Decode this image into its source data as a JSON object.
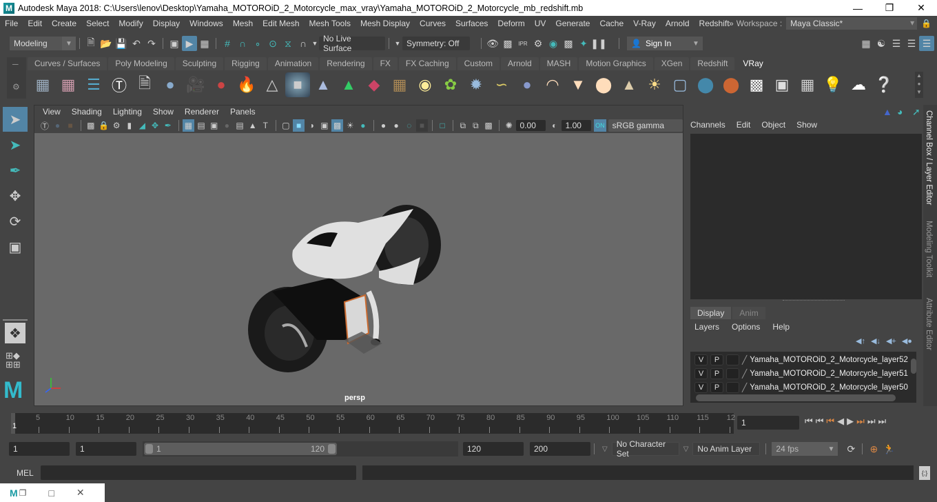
{
  "window": {
    "title": "Autodesk Maya 2018: C:\\Users\\lenov\\Desktop\\Yamaha_MOTOROiD_2_Motorcycle_max_vray\\Yamaha_MOTOROiD_2_Motorcycle_mb_redshift.mb",
    "controls": [
      "minimize",
      "restore",
      "close"
    ]
  },
  "menubar": {
    "items": [
      "File",
      "Edit",
      "Create",
      "Select",
      "Modify",
      "Display",
      "Windows",
      "Mesh",
      "Edit Mesh",
      "Mesh Tools",
      "Mesh Display",
      "Curves",
      "Surfaces",
      "Deform",
      "UV",
      "Generate",
      "Cache",
      "V-Ray",
      "Arnold",
      "Redshift"
    ],
    "workspace_label": "Workspace :",
    "workspace_value": "Maya Classic*"
  },
  "statusline": {
    "mode": "Modeling",
    "live_surface": "No Live Surface",
    "symmetry": "Symmetry: Off",
    "sign_in": "Sign In"
  },
  "shelf": {
    "tabs": [
      "Curves / Surfaces",
      "Poly Modeling",
      "Sculpting",
      "Rigging",
      "Animation",
      "Rendering",
      "FX",
      "FX Caching",
      "Custom",
      "Arnold",
      "MASH",
      "Motion Graphics",
      "XGen",
      "Redshift",
      "VRay"
    ],
    "active_tab": "VRay"
  },
  "viewport": {
    "menu": [
      "View",
      "Shading",
      "Lighting",
      "Show",
      "Renderer",
      "Panels"
    ],
    "exposure": "0.00",
    "gamma": "1.00",
    "color_space": "sRGB gamma",
    "camera": "persp"
  },
  "channel_box": {
    "menu": [
      "Channels",
      "Edit",
      "Object",
      "Show"
    ]
  },
  "layer_editor": {
    "tabs": [
      "Display",
      "Anim"
    ],
    "active_tab": "Display",
    "menu": [
      "Layers",
      "Options",
      "Help"
    ],
    "layers": [
      {
        "v": "V",
        "p": "P",
        "name": "Yamaha_MOTOROiD_2_Motorcycle_layer52"
      },
      {
        "v": "V",
        "p": "P",
        "name": "Yamaha_MOTOROiD_2_Motorcycle_layer51"
      },
      {
        "v": "V",
        "p": "P",
        "name": "Yamaha_MOTOROiD_2_Motorcycle_layer50"
      }
    ]
  },
  "side_tabs": [
    "Channel Box / Layer Editor",
    "Modeling Toolkit",
    "Attribute Editor"
  ],
  "timeline": {
    "ticks": [
      "5",
      "10",
      "15",
      "20",
      "25",
      "30",
      "35",
      "40",
      "45",
      "50",
      "55",
      "60",
      "65",
      "70",
      "75",
      "80",
      "85",
      "90",
      "95",
      "100",
      "105",
      "110",
      "115",
      "12"
    ],
    "current_frame_marker": "1",
    "current_frame": "1"
  },
  "range": {
    "start": "1",
    "playback_start": "1",
    "slider_start": "1",
    "slider_end": "120",
    "playback_end": "120",
    "end": "200",
    "character_set": "No Character Set",
    "anim_layer": "No Anim Layer",
    "fps": "24 fps"
  },
  "command_line": {
    "label": "MEL",
    "value": ""
  }
}
